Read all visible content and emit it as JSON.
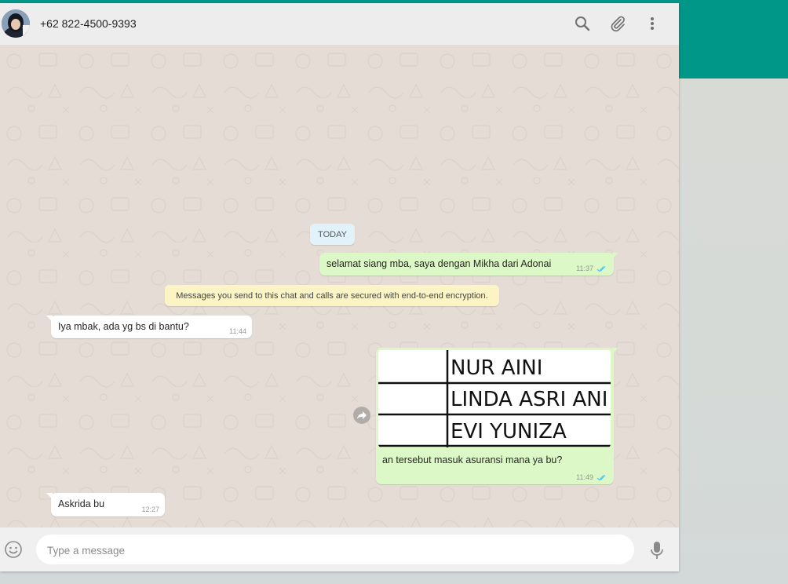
{
  "header": {
    "contact_name": "+62 822-4500-9393",
    "icons": [
      "search-icon",
      "attach-icon",
      "menu-icon"
    ]
  },
  "chat": {
    "date_label": "TODAY",
    "encryption_notice": "Messages you send to this chat and calls are secured with end-to-end encryption.",
    "messages": [
      {
        "direction": "outgoing",
        "text": "selamat siang mba, saya dengan Mikha dari Adonai",
        "time": "11:37",
        "status": "read"
      },
      {
        "direction": "incoming",
        "text": "Iya mbak,  ada yg bs di bantu?",
        "time": "11:44"
      },
      {
        "direction": "outgoing",
        "image_text": [
          "NUR AINI",
          "LINDA ASRI ANI",
          "EVI YUNIZA"
        ],
        "text": "an tersebut masuk asuransi mana ya bu?",
        "time": "11:49",
        "status": "read"
      },
      {
        "direction": "incoming",
        "text": "Askrida bu",
        "time": "12:27"
      }
    ]
  },
  "footer": {
    "placeholder": "Type a message"
  },
  "colors": {
    "teal": "#009688",
    "outgoing_bubble": "#dcf8c6",
    "incoming_bubble": "#ffffff",
    "read_ticks": "#4fc3f7"
  }
}
